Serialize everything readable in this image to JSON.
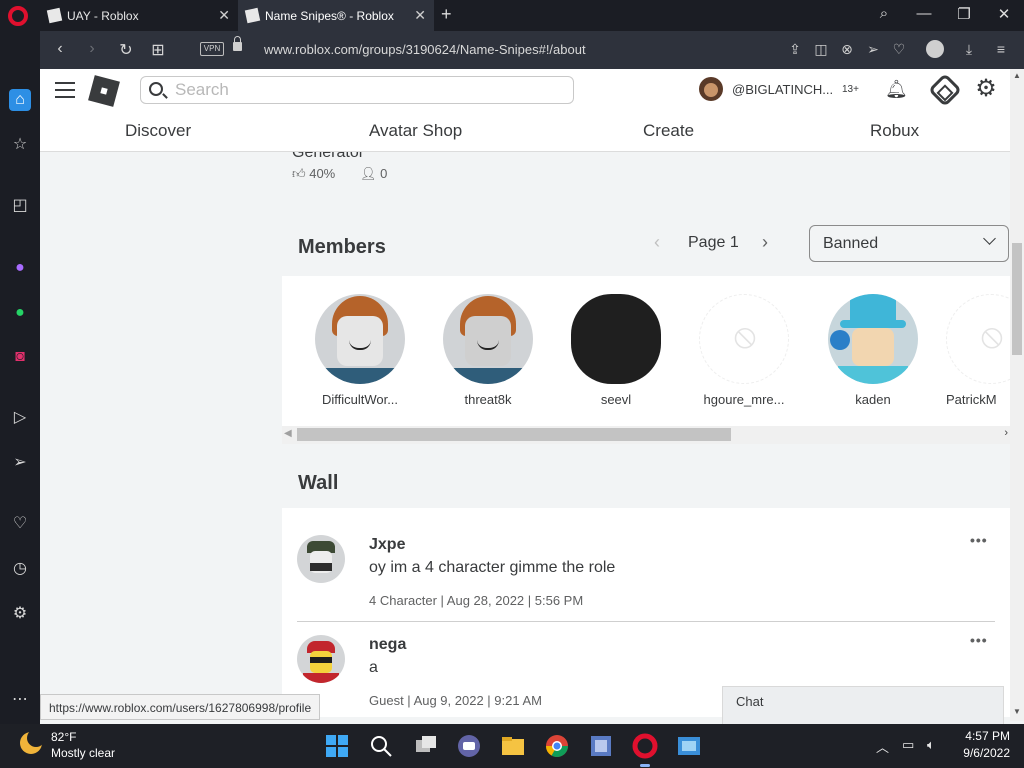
{
  "browser": {
    "tabs": [
      {
        "label": "UAY - Roblox",
        "active": false
      },
      {
        "label": "Name Snipes® - Roblox",
        "active": true
      }
    ],
    "url": "www.roblox.com/groups/3190624/Name-Snipes#!/about",
    "vpn_label": "VPN",
    "status_url": "https://www.roblox.com/users/1627806998/profile"
  },
  "header": {
    "search_placeholder": "Search",
    "username": "@BIGLATINCH...",
    "age_badge": "13+",
    "nav": [
      "Discover",
      "Avatar Shop",
      "Create",
      "Robux"
    ]
  },
  "game": {
    "title": "Generator",
    "rating": "40%",
    "players": "0"
  },
  "members": {
    "heading": "Members",
    "page_label": "Page 1",
    "role_filter": "Banned",
    "list": [
      {
        "name": "DifficultWor...",
        "avatar": "bacon"
      },
      {
        "name": "threat8k",
        "avatar": "bacon-grey"
      },
      {
        "name": "seevl",
        "avatar": "dark"
      },
      {
        "name": "hgoure_mre...",
        "avatar": "blocked"
      },
      {
        "name": "kaden",
        "avatar": "tophat"
      },
      {
        "name": "PatrickM",
        "avatar": "blocked"
      }
    ]
  },
  "wall": {
    "heading": "Wall",
    "posts": [
      {
        "author": "Jxpe",
        "body": "oy im a 4 character gimme the role",
        "meta": "4 Character | Aug 28, 2022 | 5:56 PM"
      },
      {
        "author": "nega",
        "body": "a",
        "meta": "Guest | Aug 9, 2022 | 9:21 AM"
      }
    ]
  },
  "chat": {
    "label": "Chat"
  },
  "taskbar": {
    "temp": "82°F",
    "condition": "Mostly clear",
    "time": "4:57 PM",
    "date": "9/6/2022"
  },
  "colors": {
    "brand_red": "#e0102e",
    "accent_blue": "#2d8fe5",
    "text": "#393b3d"
  }
}
